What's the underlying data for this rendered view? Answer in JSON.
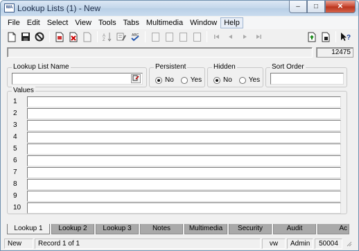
{
  "window": {
    "title": "Lookup Lists (1) - New",
    "app_icon_text": "WA",
    "minimize_glyph": "–",
    "maximize_glyph": "□",
    "close_glyph": "✕"
  },
  "menu": [
    "File",
    "Edit",
    "Select",
    "View",
    "Tools",
    "Tabs",
    "Multimedia",
    "Window",
    "Help"
  ],
  "toolbar": {
    "icons": [
      "new-document-icon",
      "save-icon",
      "cancel-icon",
      "copy-record-icon",
      "delete-record-icon",
      "blank-document-icon",
      "sort-icon",
      "edit-list-icon",
      "spellcheck-icon",
      "report-icon",
      "grid-icon",
      "form-icon",
      "preview-icon",
      "first-record-icon",
      "previous-record-icon",
      "next-record-icon",
      "last-record-icon",
      "export-icon",
      "import-icon",
      "help-pointer-icon"
    ]
  },
  "record_count": "12475",
  "form": {
    "lookup_list_name_label": "Lookup List Name",
    "lookup_list_name_value": "",
    "persistent_label": "Persistent",
    "persistent_no": "No",
    "persistent_yes": "Yes",
    "persistent_selected": "No",
    "hidden_label": "Hidden",
    "hidden_no": "No",
    "hidden_yes": "Yes",
    "hidden_selected": "No",
    "sort_order_label": "Sort Order",
    "sort_order_value": "",
    "values_label": "Values",
    "value_rows": [
      "1",
      "2",
      "3",
      "4",
      "5",
      "6",
      "7",
      "8",
      "9",
      "10"
    ]
  },
  "tabs": [
    "Lookup 1",
    "Lookup 2",
    "Lookup 3",
    "Notes",
    "Multimedia",
    "Security",
    "Audit",
    "Ac"
  ],
  "active_tab": "Lookup 1",
  "status": {
    "mode": "New",
    "record": "Record 1 of 1",
    "user_short": "vw",
    "user_role": "Admin",
    "code": "50004"
  }
}
